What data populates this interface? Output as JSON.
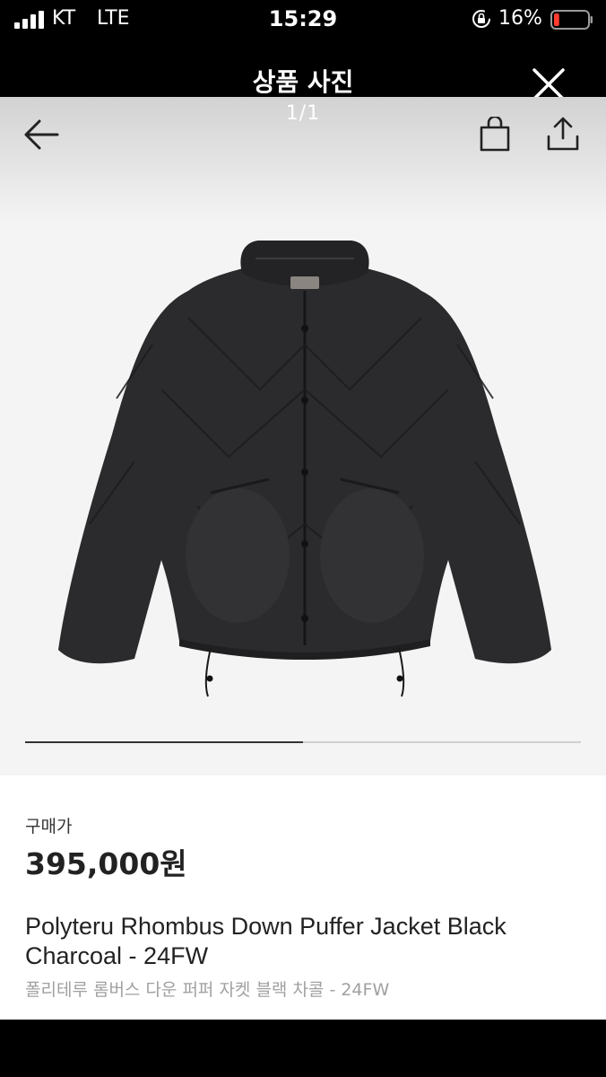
{
  "status_bar": {
    "carrier": "KT",
    "network": "LTE",
    "time": "15:29",
    "battery_percent": "16%",
    "battery_level": 0.16,
    "battery_color": "#ff3b30"
  },
  "viewer": {
    "title": "상품 사진",
    "page_counter": "1/1",
    "current_page": 1,
    "total_pages": 1,
    "progress": 0.5
  },
  "icons": {
    "back": "arrow-left-icon",
    "close": "close-icon",
    "bag": "shopping-bag-icon",
    "share": "share-icon"
  },
  "product": {
    "price_label": "구매가",
    "price": "395,000원",
    "name": "Polyteru Rhombus Down Puffer Jacket Black Charcoal - 24FW",
    "name_ko": "폴리테루 롬버스 다운 퍼퍼 자켓 블랙 차콜 - 24FW"
  }
}
